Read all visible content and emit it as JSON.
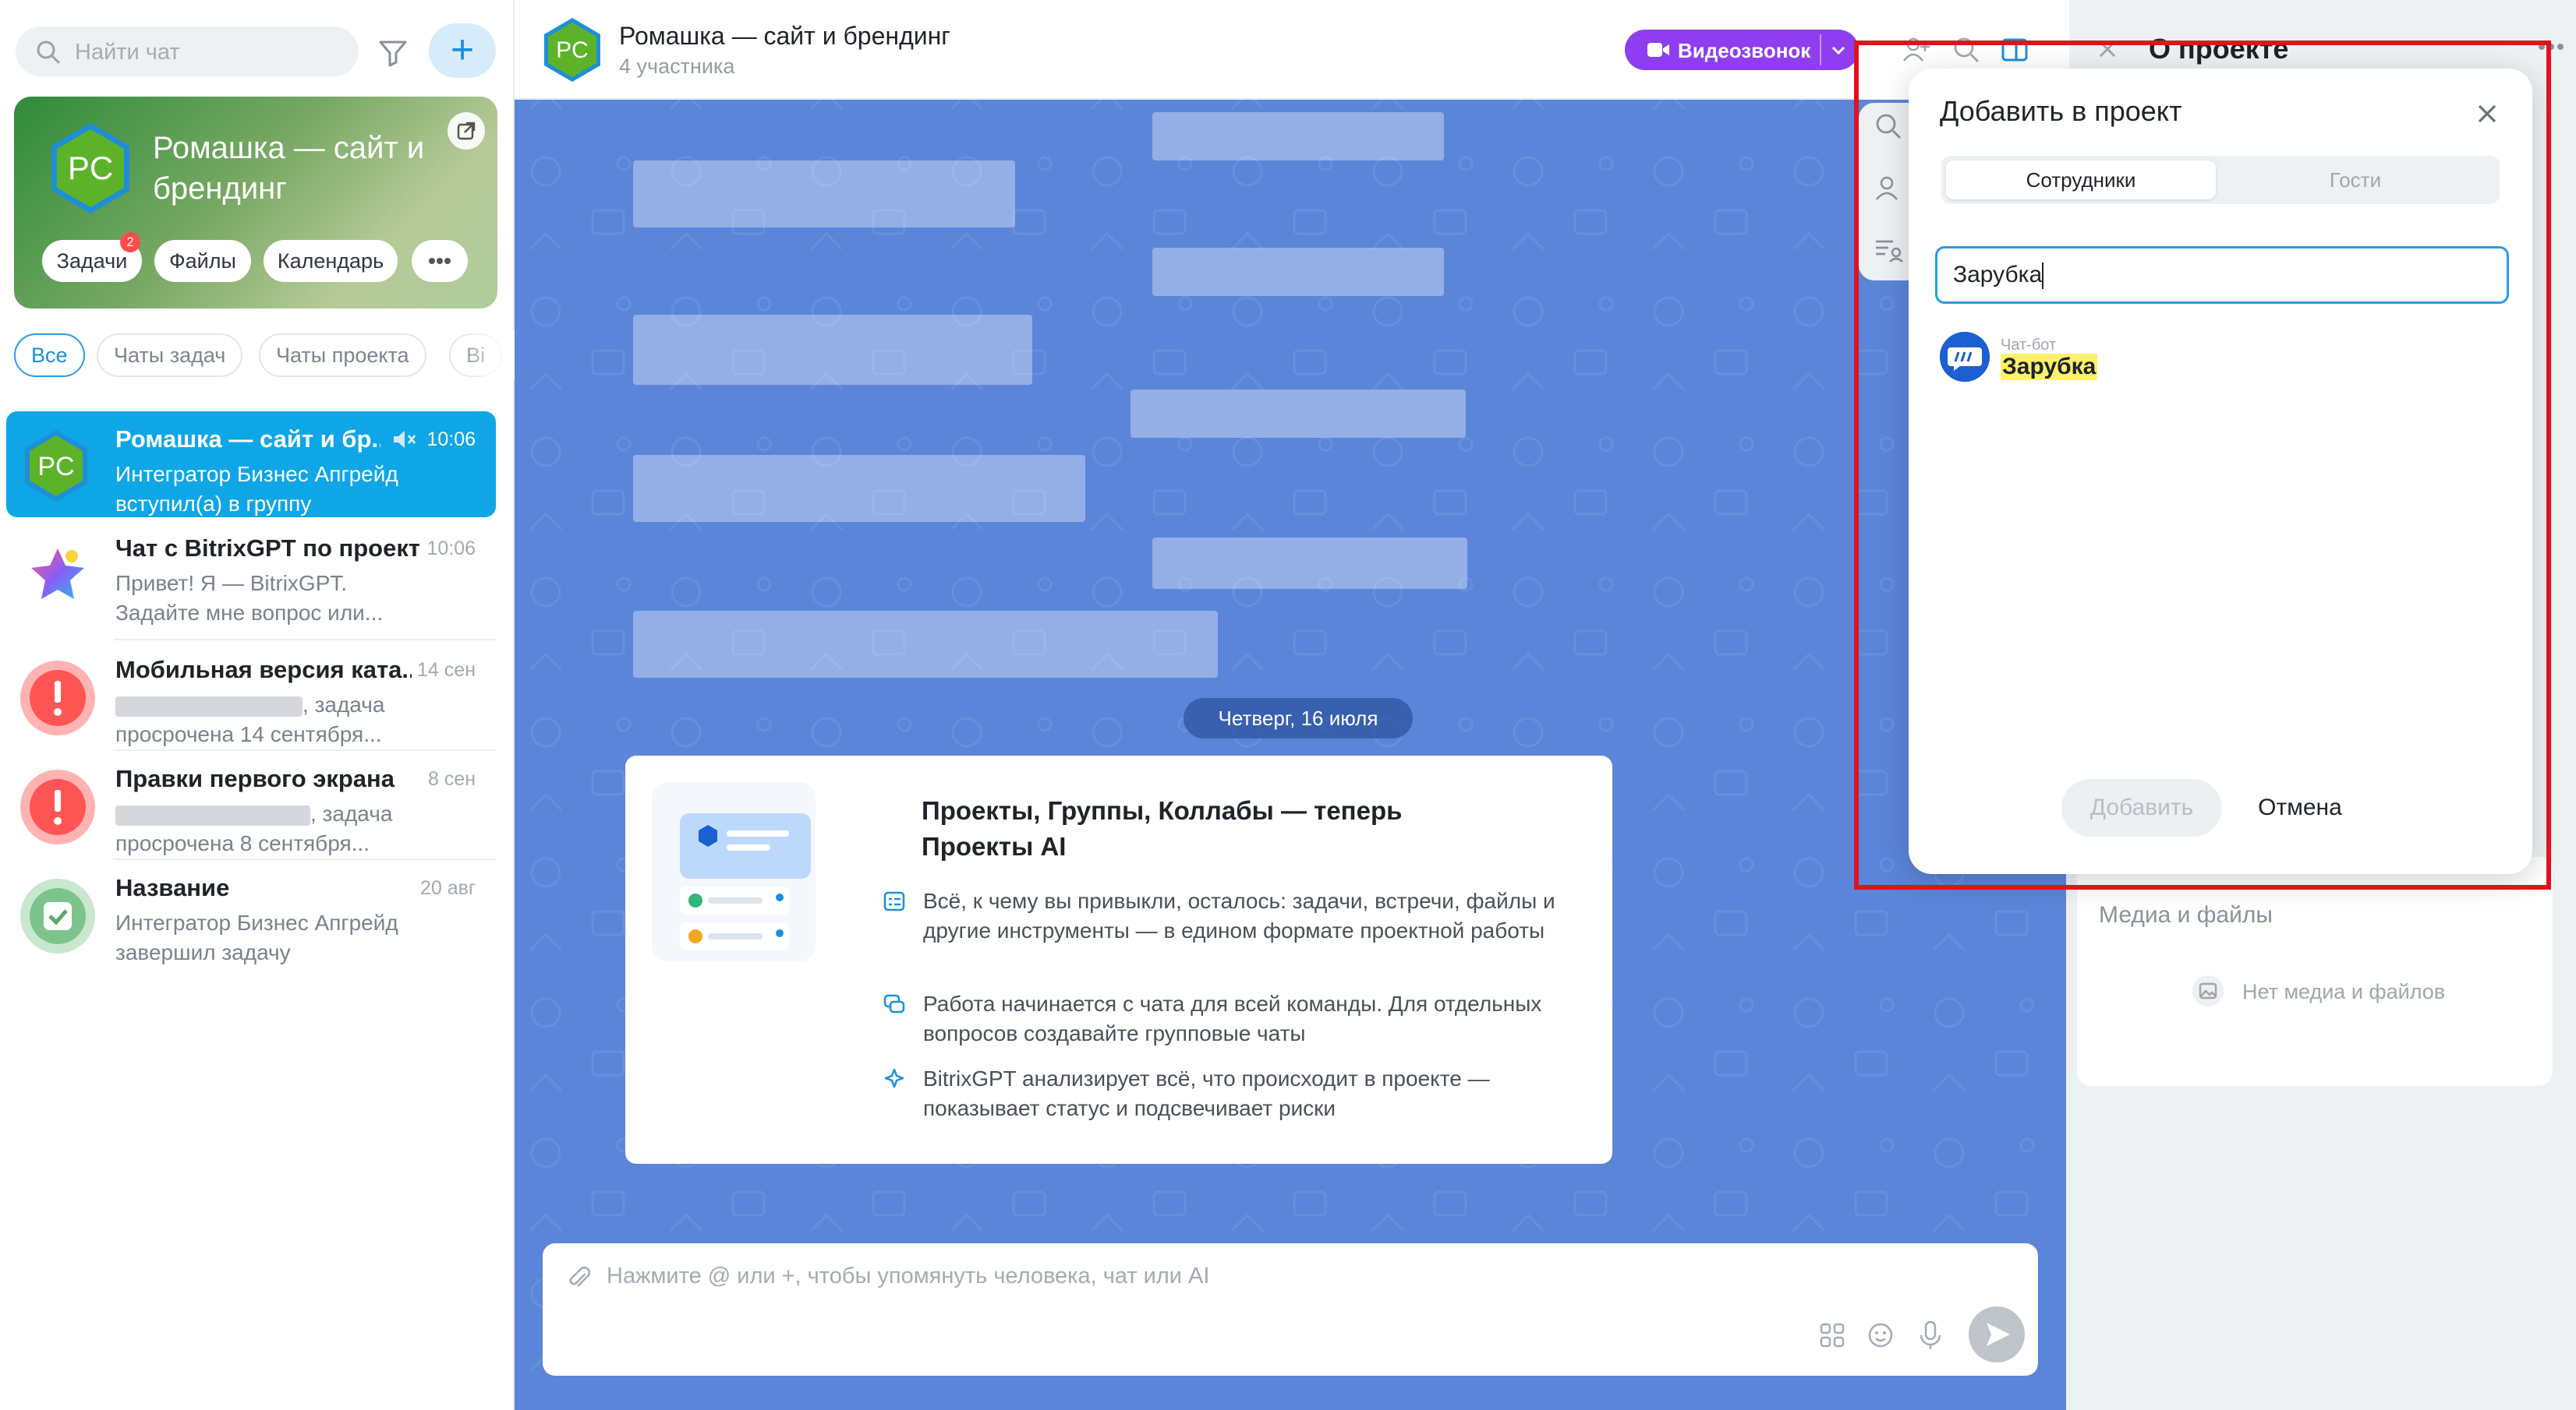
{
  "sidebar": {
    "search_placeholder": "Найти чат",
    "project_card": {
      "avatar_initials": "PC",
      "title": "Ромашка — сайт и брендинг",
      "buttons": [
        "Задачи",
        "Файлы",
        "Календарь"
      ],
      "tasks_badge": "2"
    },
    "tabs": [
      "Все",
      "Чаты задач",
      "Чаты проекта",
      "Ві"
    ],
    "chats": [
      {
        "title": "Ромашка — сайт и бр...",
        "time": "10:06",
        "line1": "Интегратор Бизнес Апгрейд",
        "line2": "вступил(а) в группу"
      },
      {
        "title": "Чат с BitrixGPT по проекту",
        "time": "10:06",
        "line1": "Привет! Я — BitrixGPT.",
        "line2": "Задайте мне вопрос или..."
      },
      {
        "title": "Мобильная версия ката...",
        "time": "14 сен",
        "line1": ", задача",
        "line2": "просрочена 14 сентября..."
      },
      {
        "title": "Правки первого экрана",
        "time": "8 сен",
        "line1": ", задача",
        "line2": "просрочена 8 сентября..."
      },
      {
        "title": "Название",
        "time": "20 авг",
        "line1": "Интегратор Бизнес Апгрейд",
        "line2": "завершил задачу"
      }
    ]
  },
  "header": {
    "avatar_initials": "PC",
    "title": "Ромашка — сайт и брендинг",
    "subtitle": "4 участника",
    "video_button": "Видеозвонок"
  },
  "chat": {
    "date_divider": "Четверг, 16 июля",
    "promo": {
      "title": "Проекты, Группы, Коллабы — теперь Проекты AI",
      "items": [
        "Всё, к чему вы привыкли, осталось: задачи, встречи, файлы и другие инструменты — в едином формате проектной работы",
        "Работа начинается с чата для всей команды. Для отдельных вопросов создавайте групповые чаты",
        "BitrixGPT анализирует всё, что происходит в проекте — показывает статус и подсвечивает риски"
      ]
    },
    "input_placeholder": "Нажмите @ или +, чтобы упомянуть человека, чат или AI"
  },
  "right_panel": {
    "title": "О проекте",
    "media_title": "Медиа и файлы",
    "media_empty": "Нет медиа и файлов"
  },
  "modal": {
    "title": "Добавить в проект",
    "segments": [
      "Сотрудники",
      "Гости"
    ],
    "search_value": "Зарубка",
    "result": {
      "label": "Чат-бот",
      "name": "Зарубка"
    },
    "add_button": "Добавить",
    "cancel_button": "Отмена"
  },
  "colors": {
    "accent": "#2b9be8",
    "selected_chat": "#0ea6e6",
    "video": "#8e3ef0",
    "chat_bg": "#5b85d9",
    "highlight": "#fff16b",
    "annotation_frame": "#e0121d"
  }
}
